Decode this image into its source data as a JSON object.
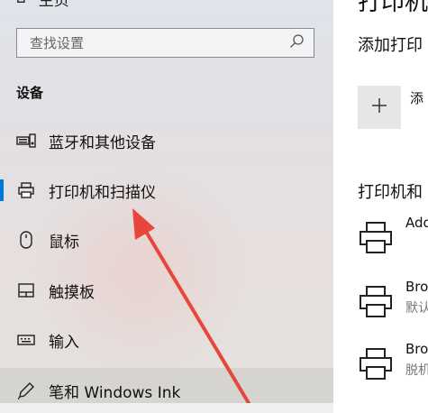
{
  "sidebar": {
    "home_label": "主页",
    "search_placeholder": "查找设置",
    "section_title": "设备",
    "items": [
      {
        "label": "蓝牙和其他设备",
        "icon": "bluetooth-devices-icon"
      },
      {
        "label": "打印机和扫描仪",
        "icon": "printer-icon"
      },
      {
        "label": "鼠标",
        "icon": "mouse-icon"
      },
      {
        "label": "触摸板",
        "icon": "touchpad-icon"
      },
      {
        "label": "输入",
        "icon": "keyboard-icon"
      },
      {
        "label": "笔和 Windows Ink",
        "icon": "pen-icon"
      }
    ]
  },
  "main": {
    "title": "打印机",
    "add_heading": "添加打印",
    "add_button_text": "添",
    "section_title": "打印机和",
    "printers": [
      {
        "name": "Ado",
        "status": ""
      },
      {
        "name": "Bro",
        "status": "默认"
      },
      {
        "name": "Bro",
        "status": "脱机"
      }
    ]
  },
  "colors": {
    "accent": "#0078d7",
    "arrow": "#e8463a"
  }
}
